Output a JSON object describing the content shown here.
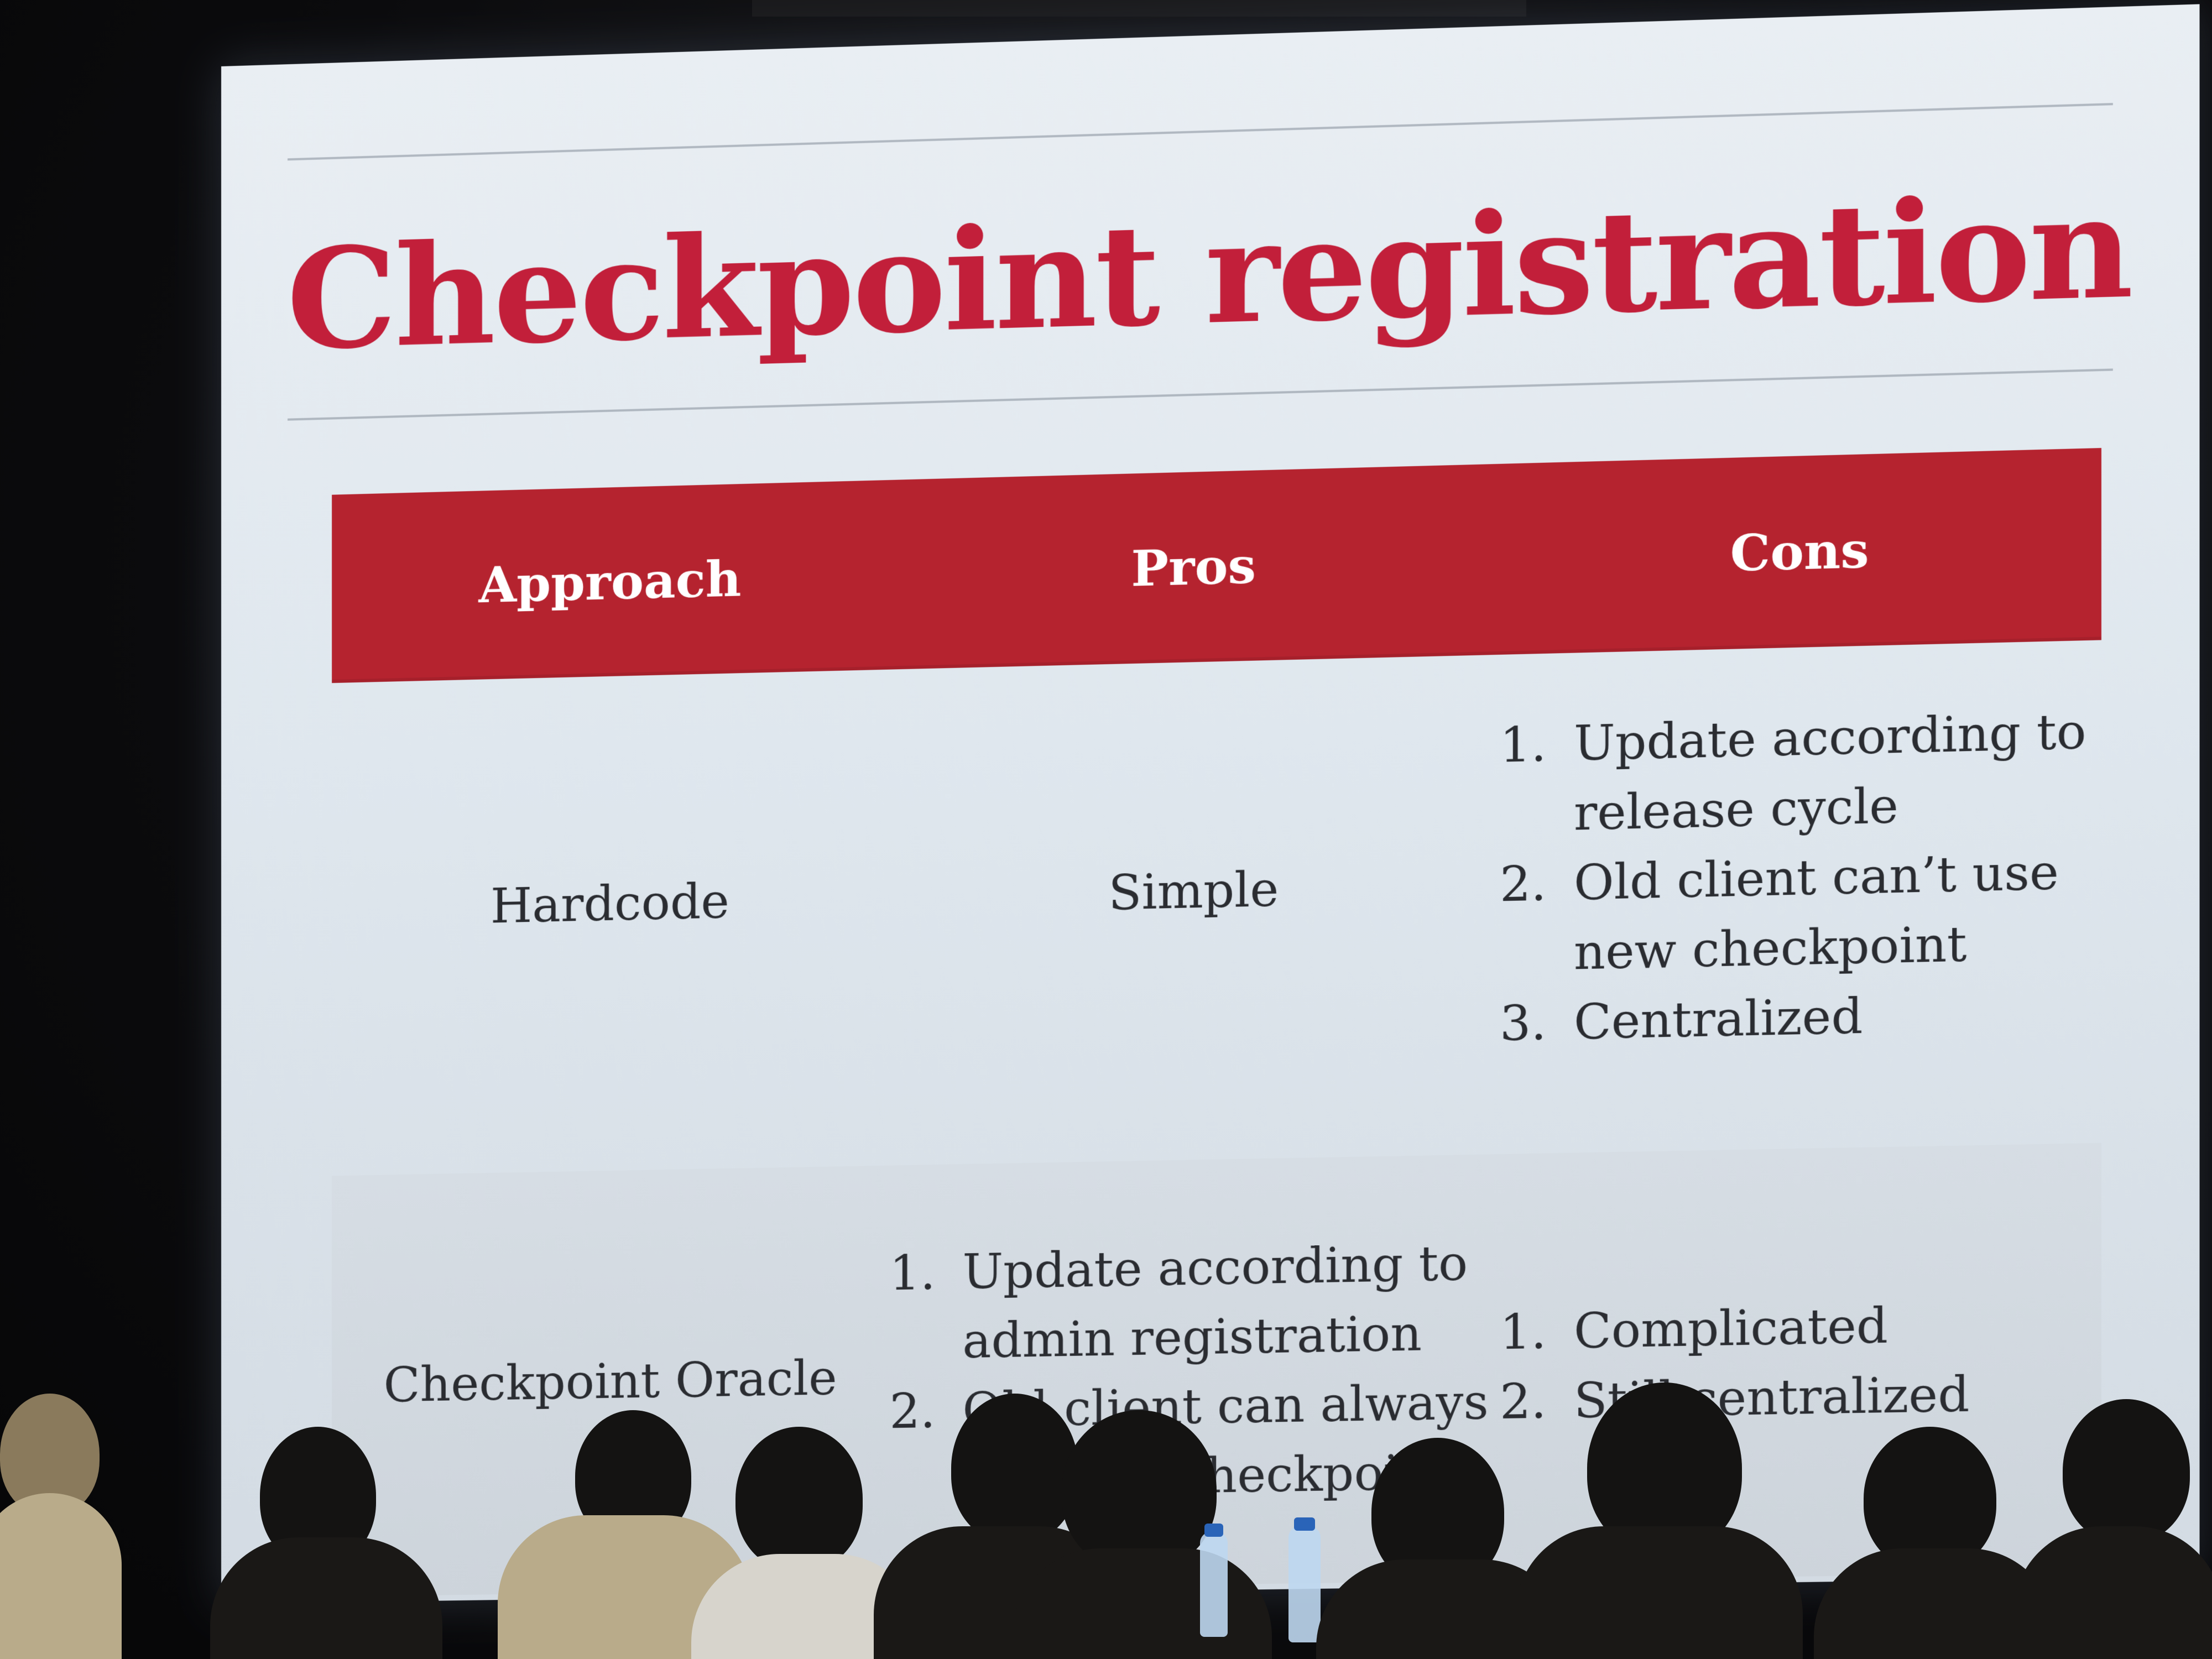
{
  "slide": {
    "title": "Checkpoint registration",
    "title_color": "#c21f3a",
    "header_color": "#b5232f"
  },
  "table": {
    "headers": [
      "Approach",
      "Pros",
      "Cons"
    ],
    "rows": [
      {
        "approach": "Hardcode",
        "pros": "Simple",
        "cons": [
          {
            "num": "1.",
            "text": "Update according to release cycle"
          },
          {
            "num": "2.",
            "text": "Old client can’t use new checkpoint"
          },
          {
            "num": "3.",
            "text": "Centralized"
          }
        ]
      },
      {
        "approach": "Checkpoint Oracle",
        "pros": [
          {
            "num": "1.",
            "text": "Update according to admin registration"
          },
          {
            "num": "2.",
            "text": "Old client can always … latest checkpoint"
          }
        ],
        "cons": [
          {
            "num": "1.",
            "text": "Complicated"
          },
          {
            "num": "2.",
            "text": "Still centralized"
          }
        ]
      }
    ]
  }
}
